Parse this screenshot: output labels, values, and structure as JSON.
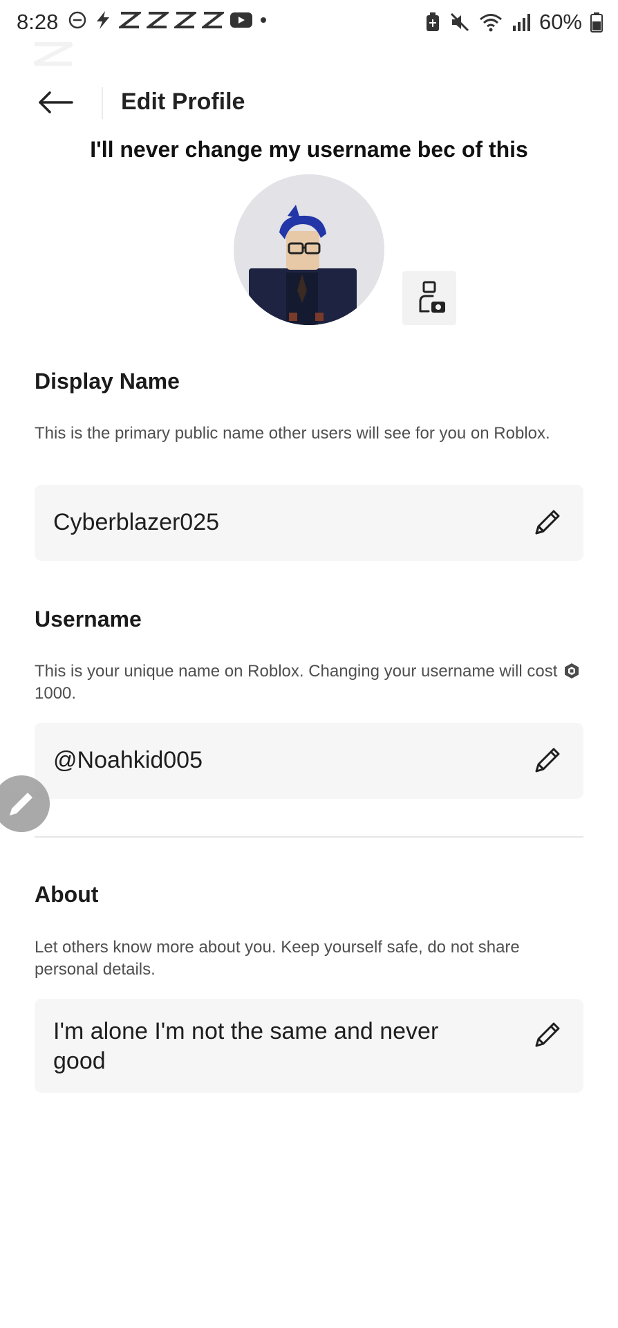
{
  "status_bar": {
    "time": "8:28",
    "left_icons": [
      "do-not-disturb-icon",
      "lightning-icon",
      "capcut-icon",
      "capcut-icon",
      "capcut-icon",
      "capcut-icon",
      "youtube-icon",
      "dot-icon"
    ],
    "right_icons": [
      "battery-saver-icon",
      "mute-icon",
      "wifi-icon",
      "signal-icon"
    ],
    "battery": "60%"
  },
  "header": {
    "title": "Edit Profile",
    "back_icon": "arrow-left-icon"
  },
  "caption": "I'll never change my username bec of this",
  "display_name": {
    "title": "Display Name",
    "description": "This is the primary public name other users will see for you on Roblox.",
    "value": "Cyberblazer025"
  },
  "username": {
    "title": "Username",
    "description_before": "This is your unique name on Roblox. Changing your username will cost ",
    "cost": "1000.",
    "value": "@Noahkid005"
  },
  "about": {
    "title": "About",
    "description": "Let others know more about you. Keep yourself safe, do not share personal details.",
    "value": "I'm alone I'm not the same and never good"
  },
  "colors": {
    "field_bg": "#f6f6f6",
    "avatar_bg": "#e2e2e7",
    "text_primary": "#1b1b1b",
    "text_secondary": "#4f4f4f"
  }
}
